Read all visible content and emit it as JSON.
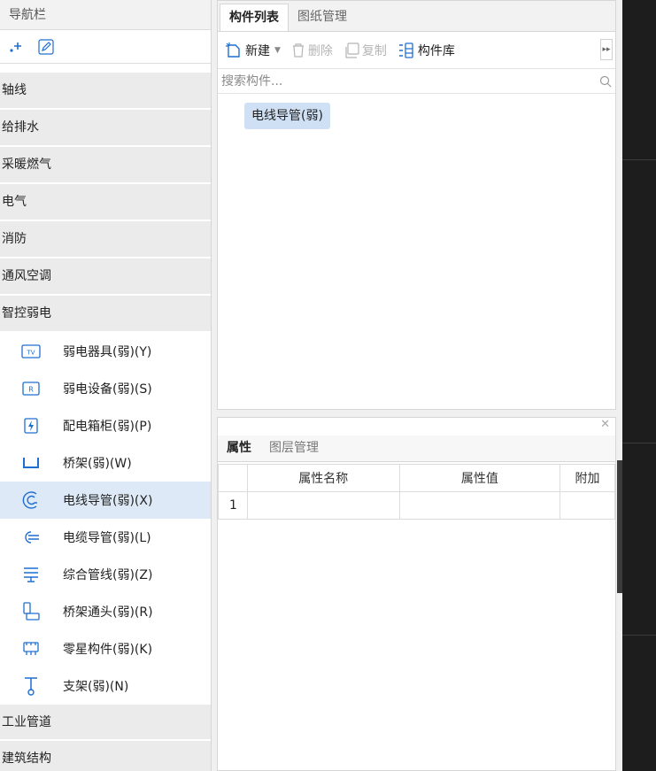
{
  "nav": {
    "title": "导航栏",
    "categories_top": [
      {
        "label": "轴线"
      },
      {
        "label": "给排水"
      },
      {
        "label": "采暖燃气"
      },
      {
        "label": "电气"
      },
      {
        "label": "消防"
      },
      {
        "label": "通风空调"
      },
      {
        "label": "智控弱电"
      }
    ],
    "sub_items": [
      {
        "label": "弱电器具(弱)(Y)",
        "icon": "tv-icon"
      },
      {
        "label": "弱电设备(弱)(S)",
        "icon": "r-box-icon"
      },
      {
        "label": "配电箱柜(弱)(P)",
        "icon": "lightning-box-icon"
      },
      {
        "label": "桥架(弱)(W)",
        "icon": "tray-icon"
      },
      {
        "label": "电线导管(弱)(X)",
        "icon": "conduit-icon"
      },
      {
        "label": "电缆导管(弱)(L)",
        "icon": "cable-conduit-icon"
      },
      {
        "label": "综合管线(弱)(Z)",
        "icon": "pipeline-icon"
      },
      {
        "label": "桥架通头(弱)(R)",
        "icon": "tray-fitting-icon"
      },
      {
        "label": "零星构件(弱)(K)",
        "icon": "misc-part-icon"
      },
      {
        "label": "支架(弱)(N)",
        "icon": "bracket-icon"
      }
    ],
    "categories_bottom": [
      {
        "label": "工业管道"
      },
      {
        "label": "建筑结构"
      }
    ],
    "active_sub_index": 4
  },
  "component_panel": {
    "tabs": [
      {
        "label": "构件列表"
      },
      {
        "label": "图纸管理"
      }
    ],
    "toolbar": {
      "new_label": "新建",
      "delete_label": "删除",
      "copy_label": "复制",
      "library_label": "构件库"
    },
    "search_placeholder": "搜索构件...",
    "items": [
      {
        "label": "电线导管(弱)"
      }
    ]
  },
  "property_panel": {
    "tabs": [
      {
        "label": "属性"
      },
      {
        "label": "图层管理"
      }
    ],
    "columns": [
      "属性名称",
      "属性值",
      "附加"
    ],
    "rows": [
      {
        "num": "1",
        "name": "",
        "value": "",
        "extra": ""
      }
    ]
  },
  "colors": {
    "active_bg": "#dde9f7",
    "category_bg": "#ebebeb",
    "icon_blue": "#1f6fd0",
    "selected_item_bg": "#cfe0f4"
  }
}
